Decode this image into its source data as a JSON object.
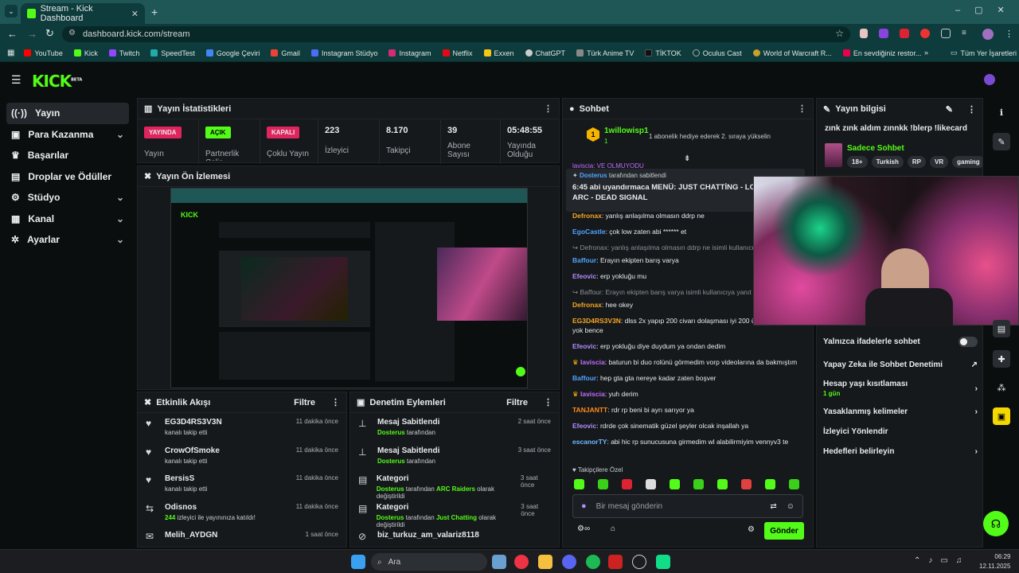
{
  "browser": {
    "tab_title": "Stream - Kick Dashboard",
    "url": "dashboard.kick.com/stream",
    "bookmarks": [
      "YouTube",
      "Kick",
      "Twitch",
      "SpeedTest",
      "Google Çeviri",
      "Gmail",
      "Instagram Stüdyo",
      "Instagram",
      "Netflix",
      "Exxen",
      "ChatGPT",
      "Türk Anime TV",
      "TİKTOK",
      "Oculus Cast",
      "World of Warcraft R...",
      "En sevdiğiniz restor..."
    ],
    "all_bookmarks": "Tüm Yer İşaretleri"
  },
  "kick": {
    "logo": "KICK",
    "logo_sup": "BETA"
  },
  "nav": [
    {
      "label": "Yayın",
      "icon": "broadcast-icon",
      "chev": ""
    },
    {
      "label": "Para Kazanma",
      "icon": "money-icon",
      "chev": "⌄"
    },
    {
      "label": "Başarılar",
      "icon": "trophy-icon",
      "chev": ""
    },
    {
      "label": "Droplar ve Ödüller",
      "icon": "gift-icon",
      "chev": ""
    },
    {
      "label": "Stüdyo",
      "icon": "gear-icon",
      "chev": "⌄"
    },
    {
      "label": "Kanal",
      "icon": "channel-icon",
      "chev": "⌄"
    },
    {
      "label": "Ayarlar",
      "icon": "settings-icon",
      "chev": "⌄"
    }
  ],
  "stats": {
    "title": "Yayın İstatistikleri",
    "items": [
      {
        "badge": "YAYINDA",
        "badge_color": "#e0245e",
        "label": "Yayın"
      },
      {
        "badge": "AÇIK",
        "badge_color": "#53fc18",
        "label": "Partnerlik Colis"
      },
      {
        "badge": "KAPALI",
        "badge_color": "#e0245e",
        "label": "Çoklu Yayın"
      },
      {
        "value": "223",
        "label": "İzleyici"
      },
      {
        "value": "8.170",
        "label": "Takipçi"
      },
      {
        "value": "39",
        "label": "Abone Sayısı"
      },
      {
        "value": "05:48:55",
        "label": "Yayında Olduğu"
      }
    ]
  },
  "preview": {
    "title": "Yayın Ön İzlemesi"
  },
  "activity": {
    "title": "Etkinlik Akışı",
    "filter": "Filtre",
    "rows": [
      {
        "name": "EG3D4RS3V3N",
        "desc": "kanalı takip etti",
        "time": "11 dakika önce",
        "icon": "heart-icon"
      },
      {
        "name": "CrowOfSmoke",
        "desc": "kanalı takip etti",
        "time": "11 dakika önce",
        "icon": "heart-icon"
      },
      {
        "name": "BersisS",
        "desc": "kanalı takip etti",
        "time": "11 dakika önce",
        "icon": "heart-icon"
      },
      {
        "name": "Odisnos",
        "desc_strong": "244",
        "desc": " izleyici ile yayınınıza katıldı!",
        "time": "11 dakika önce",
        "icon": "raid-icon"
      },
      {
        "name": "Melih_AYDGN",
        "desc": "",
        "time": "1 saat önce",
        "icon": "gift-icon"
      }
    ]
  },
  "moderation": {
    "title": "Denetim Eylemleri",
    "filter": "Filtre",
    "rows": [
      {
        "name": "Mesaj Sabitlendi",
        "who": "Dosterus",
        "rest": " tarafından",
        "time": "2 saat önce",
        "icon": "pin-icon"
      },
      {
        "name": "Mesaj Sabitlendi",
        "who": "Dosterus",
        "rest": " tarafından",
        "time": "3 saat önce",
        "icon": "pin-icon"
      },
      {
        "name": "Kategori",
        "who": "Dosterus",
        "rest": " tarafından ",
        "cat": "ARC Raiders",
        "tail": " olarak değiştirildi",
        "time": "3 saat önce",
        "icon": "category-icon"
      },
      {
        "name": "Kategori",
        "who": "Dosterus",
        "rest": " tarafından ",
        "cat": "Just Chatting",
        "tail": " olarak değiştirildi",
        "time": "3 saat önce",
        "icon": "category-icon"
      },
      {
        "name": "biz_turkuz_am_valariz8118",
        "who": "",
        "rest": "",
        "time": "",
        "icon": "ban-icon"
      }
    ]
  },
  "chat": {
    "title": "Sohbet",
    "gifter_name": "1willowisp1",
    "gifter_count": "1",
    "gift_note": "1 abonelik hediye ederek 2. sıraya yükselin",
    "gift_number": "1",
    "pinned_by": "Dosterus",
    "pinned_label": "tarafından sabitlendi",
    "pinned_text": "6:45 abi uyandırmaca MENÜ: JUST CHATTİNG - LOCKDOWN- ARC - DEAD SIGNAL",
    "top_cut": "laviscia: VE OLMUYODU",
    "messages": [
      {
        "user": "Defronax",
        "color": "#f5a623",
        "text": ": yanlış anlaşılma olmasın ddrp ne"
      },
      {
        "user": "EgoCastle",
        "color": "#4fa3ff",
        "text": ": çok low zaten abi ****** et"
      },
      {
        "reply": "Defronax: yanlış anlaşılma olmasın ddrp ne isimli kullanıcı"
      },
      {
        "user": "Baffour",
        "color": "#4fa3ff",
        "text": ": Erayın ekipten barış varya"
      },
      {
        "user": "Efeovic",
        "color": "#b48bff",
        "text": ": erp yokluğu mu"
      },
      {
        "reply": "Baffour: Erayın ekipten barış varya isimli kullanıcıya yanıt"
      },
      {
        "user": "Defronax",
        "color": "#f5a623",
        "text": ": hee okey"
      },
      {
        "user": "EG3D4RS3V3N",
        "color": "#f5a623",
        "text": ": dlss 2x yapıp 200 civarı dolaşması iyi 200 üstüyse gerek yok bence"
      },
      {
        "user": "Efeovic",
        "color": "#b48bff",
        "text": ": erp yokluğu diye duydum ya ondan dedim"
      },
      {
        "user": "laviscia",
        "color": "#c06bff",
        "crown": true,
        "text": ": baturun bi duo rolünü görmedim vorp videolarına da bakmıştım"
      },
      {
        "user": "Baffour",
        "color": "#4fa3ff",
        "text": ": hep gta gta nereye kadar zaten boşver"
      },
      {
        "user": "laviscia",
        "color": "#c06bff",
        "crown": true,
        "text": ": yuh derim"
      },
      {
        "user": "TANJANTT",
        "color": "#ff8c1a",
        "text": ": rdr rp beni bi ayrı sarıyor ya"
      },
      {
        "user": "Efeovic",
        "color": "#b48bff",
        "text": ": rdrde çok sinematik güzel şeyler olcak inşallah ya"
      },
      {
        "user": "escanorTY",
        "color": "#6db6ff",
        "text": ": abi hic rp sunucusuna girmedim wl alabilirmiyim vennyv3 te"
      }
    ],
    "followers_only": "Takipçilere Özel",
    "input_placeholder": "Bir mesaj gönderin",
    "send": "Gönder"
  },
  "info": {
    "title": "Yayın bilgisi",
    "stream_title": "zınk zınk aldım zınnkk !blerp !likecard",
    "category": "Sadece Sohbet",
    "tags": [
      "18+",
      "Turkish",
      "RP",
      "VR",
      "gaming"
    ],
    "emote_only": "Yalnızca ifadelerle sohbet",
    "ai_mod": "Yapay Zeka ile Sohbet Denetimi",
    "age_limit": "Hesap yaşı kısıtlaması",
    "age_value": "1 gün",
    "banned_words": "Yasaklanmış kelimeler",
    "redirect": "İzleyici Yönlendir",
    "goals": "Hedefleri belirleyin"
  },
  "taskbar": {
    "search": "Ara",
    "time": "06:29",
    "date": "12.11.2025"
  }
}
